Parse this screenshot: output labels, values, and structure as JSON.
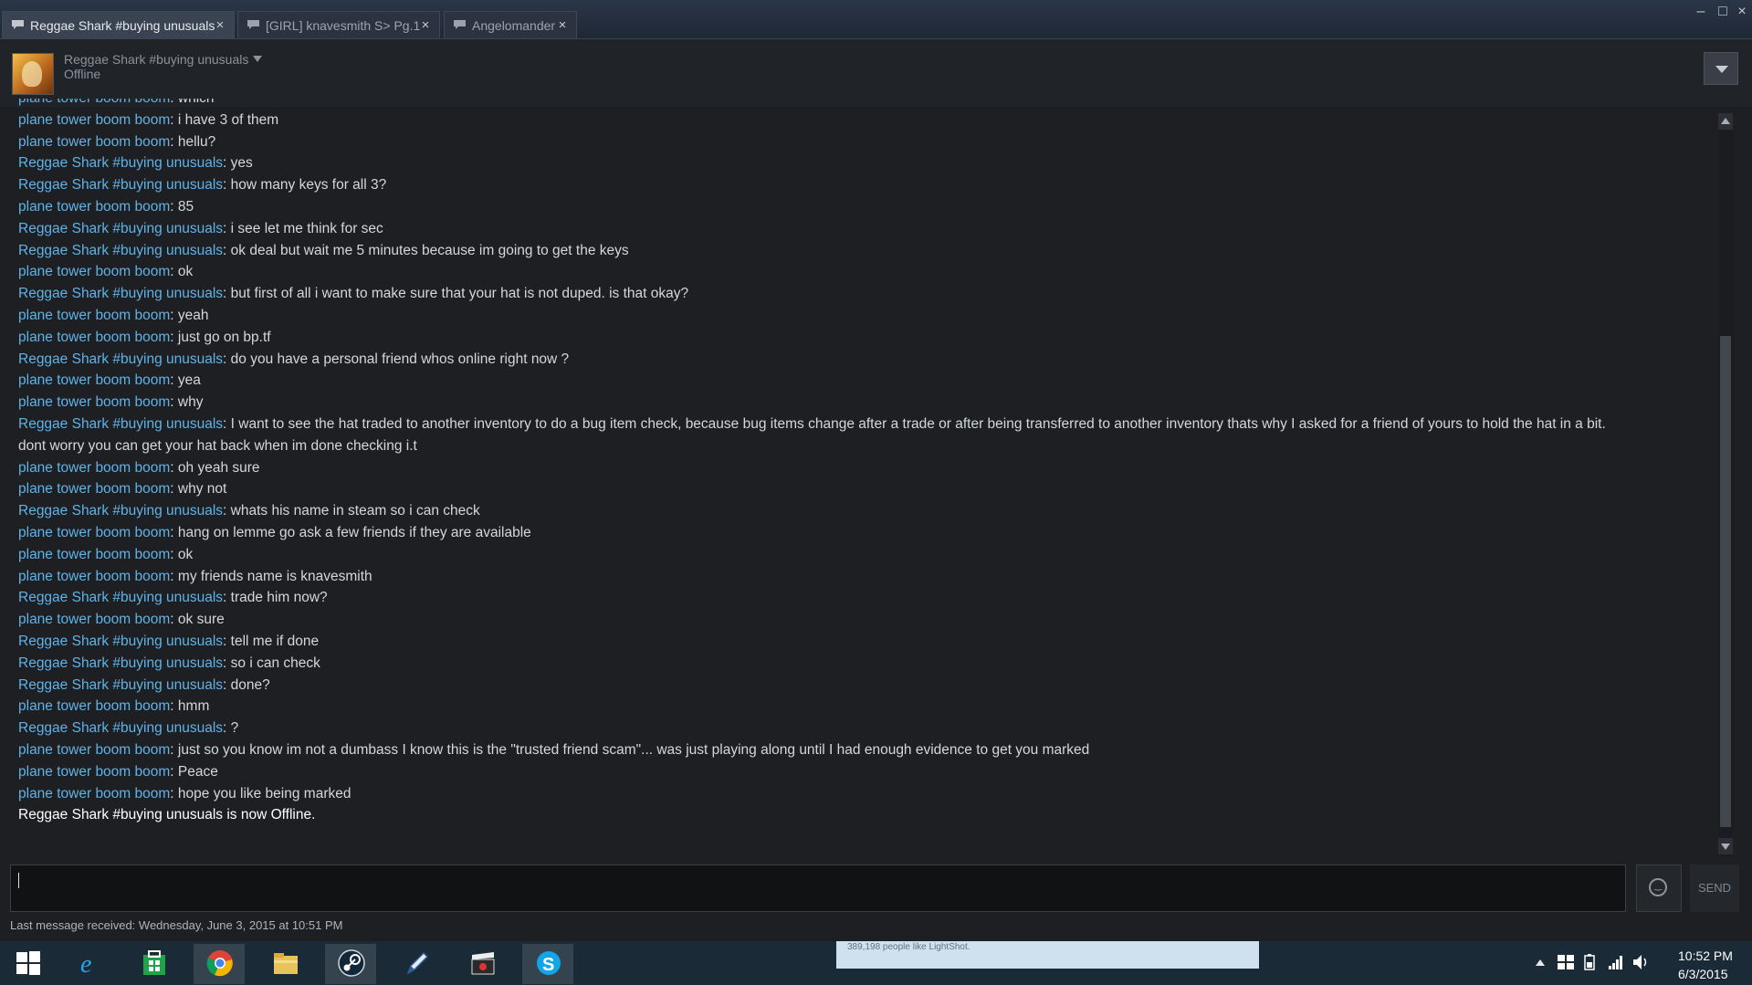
{
  "tabs": [
    {
      "label": "Reggae Shark #buying unusuals",
      "active": true
    },
    {
      "label": "[GIRL] knavesmith S> Pg.1",
      "active": false
    },
    {
      "label": "Angelomander",
      "active": false
    }
  ],
  "window": {
    "minimize": "–",
    "maximize": "□",
    "close": "×"
  },
  "header": {
    "name": "Reggae Shark #buying unusuals",
    "status": "Offline"
  },
  "messages": [
    {
      "who": "plane tower boom boom",
      "text": ": which"
    },
    {
      "who": "plane tower boom boom",
      "text": ": i have 3 of them"
    },
    {
      "who": "plane tower boom boom",
      "text": ": hellu?"
    },
    {
      "who": "Reggae Shark #buying unusuals",
      "text": ": yes"
    },
    {
      "who": "Reggae Shark #buying unusuals",
      "text": ": how many keys for all 3?"
    },
    {
      "who": "plane tower boom boom",
      "text": ": 85"
    },
    {
      "who": "Reggae Shark #buying unusuals",
      "text": ": i see let me think for sec"
    },
    {
      "who": "Reggae Shark #buying unusuals",
      "text": ": ok deal but wait me 5 minutes because im going to get the keys"
    },
    {
      "who": "plane tower boom boom",
      "text": ": ok"
    },
    {
      "who": "Reggae Shark #buying unusuals",
      "text": ": but first of all i want to make sure that your hat is not duped. is that okay?"
    },
    {
      "who": "plane tower boom boom",
      "text": ": yeah"
    },
    {
      "who": "plane tower boom boom",
      "text": ": just go on bp.tf"
    },
    {
      "who": "Reggae Shark #buying unusuals",
      "text": ": do you have  a personal friend whos online right now ?"
    },
    {
      "who": "plane tower boom boom",
      "text": ": yea"
    },
    {
      "who": "plane tower boom boom",
      "text": ": why"
    },
    {
      "who": "Reggae Shark #buying unusuals",
      "text": ": I want to see the hat traded to another inventory to do a bug item check, because bug items change after a trade or after being transferred to another inventory thats why I asked for a friend of yours to hold the hat in a bit."
    },
    {
      "who": "",
      "text": "dont worry you can get your hat back when im done checking i.t"
    },
    {
      "who": "plane tower boom boom",
      "text": ": oh yeah sure"
    },
    {
      "who": "plane tower boom boom",
      "text": ": why not"
    },
    {
      "who": "Reggae Shark #buying unusuals",
      "text": ": whats his name in steam so i can check"
    },
    {
      "who": "plane tower boom boom",
      "text": ": hang on lemme go ask a few friends if they are available"
    },
    {
      "who": "plane tower boom boom",
      "text": ": ok"
    },
    {
      "who": "plane tower boom boom",
      "text": ": my friends name is knavesmith"
    },
    {
      "who": "Reggae Shark #buying unusuals",
      "text": ": trade him now?"
    },
    {
      "who": "plane tower boom boom",
      "text": ": ok sure"
    },
    {
      "who": "Reggae Shark #buying unusuals",
      "text": ": tell me if done"
    },
    {
      "who": "Reggae Shark #buying unusuals",
      "text": ": so i can check"
    },
    {
      "who": "Reggae Shark #buying unusuals",
      "text": ": done?"
    },
    {
      "who": "plane tower boom boom",
      "text": ": hmm"
    },
    {
      "who": "Reggae Shark #buying unusuals",
      "text": ": ?"
    },
    {
      "who": "plane tower boom boom",
      "text": ": just so you know im not a dumbass I know this is the \"trusted friend scam\"... was just playing along until I had enough evidence to get you marked"
    },
    {
      "who": "plane tower boom boom",
      "text": ": Peace"
    },
    {
      "who": "plane tower boom boom",
      "text": ": hope you like being marked"
    }
  ],
  "status_line": "Reggae Shark #buying unusuals is now Offline.",
  "composer": {
    "send_label": "SEND"
  },
  "footer": {
    "last_message": "Last message received: Wednesday, June 3, 2015 at 10:51 PM"
  },
  "taskbar": {
    "apps": [
      "windows-start",
      "internet-explorer",
      "store",
      "chrome",
      "file-explorer",
      "steam",
      "editor",
      "video",
      "skype"
    ],
    "preview_text": "389,198 people like LightShot.",
    "clock_time": "10:52 PM",
    "clock_date": "6/3/2015"
  },
  "colors": {
    "name_link": "#5fb3e8",
    "message_text": "#d4d7db",
    "background": "#1d1f22"
  }
}
